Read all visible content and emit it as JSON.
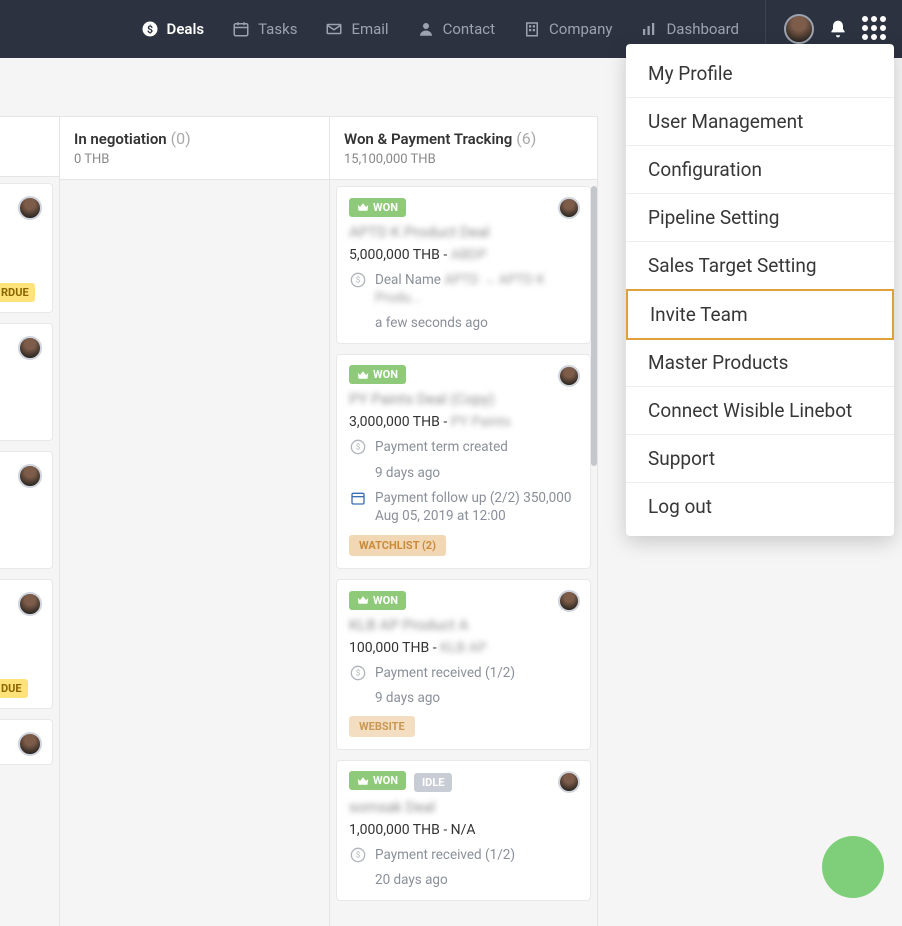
{
  "nav": {
    "deals": "Deals",
    "tasks": "Tasks",
    "email": "Email",
    "contact": "Contact",
    "company": "Company",
    "dashboard": "Dashboard"
  },
  "dropdown": {
    "profile": "My Profile",
    "user_mgmt": "User Management",
    "config": "Configuration",
    "pipeline": "Pipeline Setting",
    "sales_target": "Sales Target Setting",
    "invite": "Invite Team",
    "master": "Master Products",
    "linebot": "Connect Wisible Linebot",
    "support": "Support",
    "logout": "Log out"
  },
  "columns": {
    "neg": {
      "title": "In negotiation",
      "count": "(0)",
      "sub": "0 THB"
    },
    "won": {
      "title": "Won & Payment Tracking",
      "count": "(6)",
      "sub": "15,100,000 THB"
    }
  },
  "left_cards": {
    "overdue1": "RDUE",
    "overdue2": "DUE"
  },
  "cards": [
    {
      "won_label": "WON",
      "title_blur": "APTD K Product Deal",
      "amount": "5,000,000 THB -",
      "amount_blur": "ABDP",
      "line1_label": "Deal Name",
      "line1_blur": "APTD → APTD K Produ...",
      "line1_time": "a few seconds ago"
    },
    {
      "won_label": "WON",
      "title_blur": "PY Paints Deal (Copy)",
      "amount": "3,000,000 THB -",
      "amount_blur": "PY Paints",
      "line1_label": "Payment term created",
      "line1_time": "9 days ago",
      "followup_label": "Payment follow up (2/2) 350,000",
      "followup_sub": "Aug 05, 2019 at 12:00",
      "tag": "WATCHLIST (2)"
    },
    {
      "won_label": "WON",
      "title_blur": "KLB AP Product A",
      "amount": "100,000 THB -",
      "amount_blur": "KLB AP",
      "line1_label": "Payment received (1/2)",
      "line1_time": "9 days ago",
      "tag": "WEBSITE"
    },
    {
      "won_label": "WON",
      "idle_label": "IDLE",
      "title_blur": "somsak Deal",
      "amount": "1,000,000 THB - N/A",
      "line1_label": "Payment received (1/2)",
      "line1_time": "20 days ago"
    }
  ]
}
